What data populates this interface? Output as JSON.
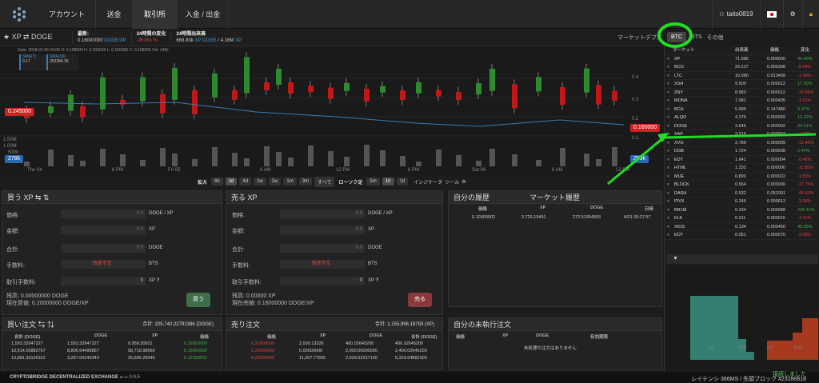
{
  "nav": {
    "items": [
      "アカウント",
      "送金",
      "取引所",
      "入金 / 出金"
    ],
    "user": "taito0819"
  },
  "ticker": {
    "pair": "XP ⇄ DOGE",
    "latest_label": "最新:",
    "latest": "0.16000000",
    "latest_unit": "DOGE/XP",
    "change_label": "24時間の変化",
    "change": "-35.6% %",
    "high_label": "24時間出来高",
    "high": "668.83k",
    "high_xp": "XP",
    "high2": "DOGE",
    "vol": "4.16M",
    "vol_unit": "XP"
  },
  "market_tabs": {
    "label": "マーケットデプス",
    "btc": "BTC",
    "bts": "BTS",
    "other": "その他"
  },
  "chart": {
    "legend": "Date: 2018-01-06 04:00  O: 0.198000  H: 0.200000  L: 0.150000  C: 0.198000  Vol: 140k",
    "sma1_label": "SMA(7)",
    "sma1": "0.17",
    "sma2_label": "SMA(30)",
    "sma2": "353384.35",
    "price_left": "0.245000",
    "price_right": "0.160000",
    "vol_left": "278k",
    "vol_right": "259k",
    "y_ticks": [
      "0.4",
      "0.3",
      "0.2",
      "0.1"
    ],
    "vol_ticks": [
      "1.50M",
      "1.00M",
      "500k"
    ],
    "x_ticks": [
      "Thu 04",
      "6 PM",
      "Fri 05",
      "6 AM",
      "12 PM",
      "6 PM",
      "Sat 06",
      "6 AM",
      "12 PM"
    ]
  },
  "zoom": {
    "label": "拡大",
    "items": [
      "6h",
      "2d",
      "4d",
      "1w",
      "2w",
      "1m",
      "3m",
      "すべて"
    ],
    "candle_label": "ローソク足",
    "candle_items": [
      "5m",
      "1h",
      "1d"
    ],
    "indicator": "インジケータ",
    "tools": "ツール"
  },
  "buy": {
    "title": "買う XP ⇆ ⇅",
    "price": "価格:",
    "amount": "金額:",
    "total": "合計:",
    "fee": "手数料:",
    "fee_value": "残高不足",
    "fee_unit": "BTS",
    "trade_fee": "取引手数料:",
    "trade_fee_value": "0",
    "unit1": "DOGE / XP",
    "unit2": "XP",
    "unit3": "DOGE",
    "unit4": "XP",
    "zero": "0.0",
    "balance_label": "残高:",
    "balance": "0.00000000 DOGE",
    "current_label": "現在買値:",
    "current": "0.20000000 DOGE/XP",
    "button": "買う"
  },
  "sell": {
    "title": "売る XP",
    "price": "価格:",
    "amount": "金額:",
    "total": "合計:",
    "fee": "手数料:",
    "fee_value": "残高不足",
    "fee_unit": "BTS",
    "trade_fee": "取引手数料:",
    "trade_fee_value": "0",
    "unit1": "DOGE / XP",
    "unit2": "XP",
    "unit3": "DOGE",
    "unit4": "XP",
    "zero": "0.0",
    "balance_label": "残高:",
    "balance": "0.00000 XP",
    "current_label": "現在売値:",
    "current": "0.16000000 DOGE/XP",
    "button": "売る"
  },
  "history": {
    "tab1": "自分の履歴",
    "tab2": "マーケット履歴",
    "headers": [
      "価格",
      "XP",
      "DOGE",
      "日時"
    ],
    "rows": [
      [
        "0.10000002",
        "2,725.19491",
        "272.51954555",
        "6/01 00:27:57"
      ]
    ]
  },
  "buy_orders": {
    "title": "買い注文 ⇆ ⇅",
    "total": "合計: 205,740.22791386 (DOGE)",
    "headers": [
      "合計 (DOGE)",
      "DOGE",
      "XP",
      "価格"
    ],
    "rows": [
      [
        "1,593.32947227",
        "1,593.32947227",
        "9,958.30921",
        "0.16000000"
      ],
      [
        "10,614.26882767",
        "8,806.64499857",
        "58,710.98666",
        "0.15000000"
      ],
      [
        "13,881.33126110",
        "3,267.06243343",
        "26,585.25646",
        "0.12289001"
      ]
    ]
  },
  "sell_orders": {
    "title": "売り注文",
    "total": "合計: 1,155,996.19793 (XP)",
    "headers": [
      "価格",
      "XP",
      "DOGE",
      "合計 (DOGE)"
    ],
    "rows": [
      [
        "0.20000000",
        "2,000.13226",
        "400.02645200",
        "400.02645200"
      ],
      [
        "0.20000000",
        "0.00000000",
        "2,000.00000000",
        "2,400.02645200"
      ],
      [
        "0.26000000",
        "11,267.77835",
        "2,929.62237100",
        "5,329.64882300"
      ]
    ]
  },
  "open_orders": {
    "title": "自分の未執行注文",
    "headers": [
      "価格",
      "XP",
      "DOGE",
      "有効期限"
    ],
    "empty": "未処理の注文はありません"
  },
  "markets": {
    "headers": [
      "マーケット",
      "出来高",
      "価格",
      "変化"
    ],
    "rows": [
      [
        "XP",
        "71.986",
        "0.000000",
        "44.95%",
        "g"
      ],
      [
        "BCO",
        "20.237",
        "0.000398",
        "-5.04%",
        "r"
      ],
      [
        "LTC",
        "10.980",
        "0.013499",
        "-1.49%",
        "r"
      ],
      [
        "XSH",
        "9.509",
        "0.000012",
        "17.30%",
        "g"
      ],
      [
        "ZNY",
        "8.983",
        "0.000012",
        "-15.89%",
        "r"
      ],
      [
        "MONA",
        "7.081",
        "0.000405",
        "-1.51%",
        "r"
      ],
      [
        "BCH",
        "5.995",
        "0.147480",
        "9.37%",
        "g"
      ],
      [
        "ALQO",
        "4.276",
        "0.000059",
        "13.32%",
        "g"
      ],
      [
        "DOGE",
        "3.645",
        "0.000002",
        "34.51%",
        "g"
      ],
      [
        "XAP",
        "3.515",
        "0.000007",
        "-1.22%",
        "r"
      ],
      [
        "XVG",
        "2.789",
        "0.000009",
        "-15.40%",
        "r"
      ],
      [
        "DGB",
        "1.724",
        "0.000008",
        "2.44%",
        "g"
      ],
      [
        "EDT",
        "1.641",
        "0.000004",
        "-0.46%",
        "r"
      ],
      [
        "HTML",
        "1.332",
        "0.000000",
        "-11.85%",
        "r"
      ],
      [
        "MUE",
        "0.893",
        "0.000022",
        "-1.55%",
        "r"
      ],
      [
        "BLOCK",
        "0.564",
        "0.003000",
        "-17.79%",
        "r"
      ],
      [
        "DASH",
        "0.532",
        "0.051001",
        "-46.53%",
        "r"
      ],
      [
        "PIVX",
        "0.246",
        "0.000613",
        "-3.29%",
        "r"
      ],
      [
        "BR1M",
        "0.234",
        "0.000068",
        "238.41%",
        "g"
      ],
      [
        "KLK",
        "0.211",
        "0.000015",
        "-3.31%",
        "r"
      ],
      [
        "XIOS",
        "0.134",
        "0.000450",
        "49.95%",
        "g"
      ],
      [
        "EOT",
        "0.051",
        "0.000070",
        "-3.69%",
        "r"
      ]
    ]
  },
  "depth": {
    "x_ticks": [
      "0.1",
      "0.15",
      "0.2",
      "0.25"
    ]
  },
  "status": {
    "left": "CRYPTOBRIDGE DECENTRALIZED EXCHANGE",
    "beta": "BETA",
    "version": "0.9.5",
    "connected": "接続しました",
    "latency": "レイテンシ 366MS / 先頭ブロック #23286818"
  },
  "colors": {
    "green": "#3cb043",
    "red": "#d02020",
    "blue": "#4a9bd4",
    "annotation": "#22dd22"
  }
}
